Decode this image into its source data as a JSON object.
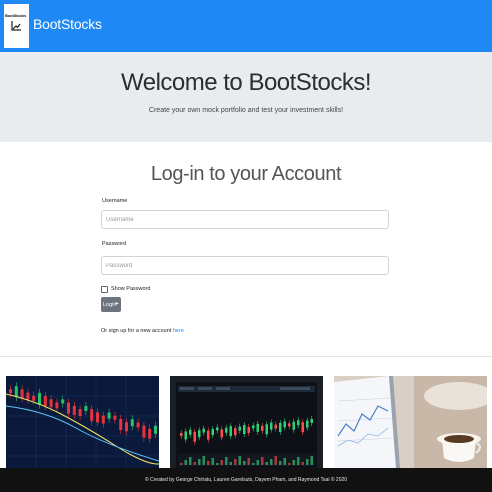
{
  "navbar": {
    "logo_text": "BootStocks",
    "brand": "BootStocks",
    "colors": {
      "background": "#1e88f5",
      "logo_bg": "#ffffff"
    }
  },
  "jumbotron": {
    "title": "Welcome to BootStocks!",
    "subtitle": "Create your own mock portfolio and test your investment skills!"
  },
  "login": {
    "title": "Log-in to your Account",
    "username_label": "Username",
    "username_placeholder": "Username",
    "password_label": "Password",
    "password_placeholder": "Password",
    "show_password_label": "Show Password",
    "show_password_checked": false,
    "login_button": "Login",
    "login_icon": "sign-in-icon",
    "signup_prefix": "Or sign up for a new account",
    "signup_link": "here"
  },
  "cards": [
    {
      "name": "stock-chart-red-candles-image"
    },
    {
      "name": "trading-screen-image"
    },
    {
      "name": "laptop-coffee-chart-image"
    }
  ],
  "footer": {
    "text": "© Created by George Chiriatu, Lauren Garelsuts, Dayem Pham, and Raymond Tsai © 2020"
  }
}
